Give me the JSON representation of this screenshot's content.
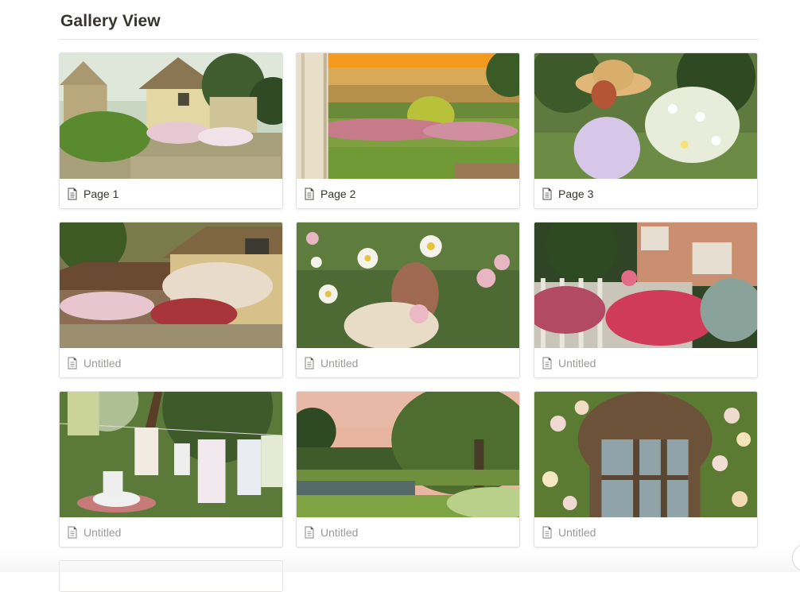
{
  "page": {
    "title": "Gallery View"
  },
  "gallery": {
    "cards": [
      {
        "label": "Page 1",
        "titled": true,
        "image": "cotswold-thatched-cottage"
      },
      {
        "label": "Page 2",
        "titled": true,
        "image": "garden-through-window-sunset"
      },
      {
        "label": "Page 3",
        "titled": true,
        "image": "woman-straw-hat-daisies"
      },
      {
        "label": "Untitled",
        "titled": false,
        "image": "rose-covered-cottage"
      },
      {
        "label": "Untitled",
        "titled": false,
        "image": "girl-in-daisy-meadow"
      },
      {
        "label": "Untitled",
        "titled": false,
        "image": "roses-white-picket-fence"
      },
      {
        "label": "Untitled",
        "titled": false,
        "image": "laundry-line-orchard"
      },
      {
        "label": "Untitled",
        "titled": false,
        "image": "willow-tree-pond"
      },
      {
        "label": "Untitled",
        "titled": false,
        "image": "arched-window-roses"
      }
    ]
  },
  "icons": {
    "card_icon": "page-doc-icon"
  },
  "colors": {
    "text": "#37352f",
    "muted": "#9b9a97",
    "border": "#e3e2e0"
  }
}
